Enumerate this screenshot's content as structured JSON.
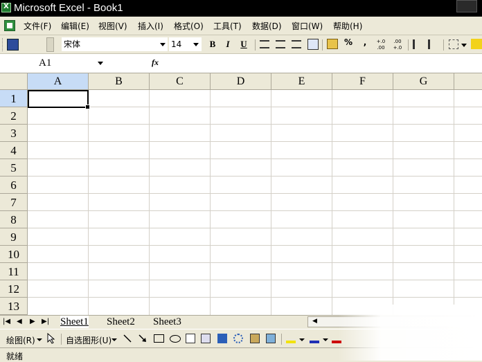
{
  "window": {
    "title": "Microsoft Excel - Book1"
  },
  "menu": [
    "文件(F)",
    "编辑(E)",
    "视图(V)",
    "插入(I)",
    "格式(O)",
    "工具(T)",
    "数据(D)",
    "窗口(W)",
    "帮助(H)"
  ],
  "toolbar": {
    "font_name": "宋体",
    "font_size": "14",
    "bold": "B",
    "italic": "I",
    "underline": "U",
    "percent": "%",
    "comma": ",",
    "increase_decimal": "+.0 .00",
    "decrease_decimal": ".00 +.0"
  },
  "formula_bar": {
    "name_box": "A1",
    "fx": "fx",
    "value": ""
  },
  "grid": {
    "columns": [
      "A",
      "B",
      "C",
      "D",
      "E",
      "F",
      "G"
    ],
    "rows": [
      "1",
      "2",
      "3",
      "4",
      "5",
      "6",
      "7",
      "8",
      "9",
      "10",
      "11",
      "12",
      "13"
    ],
    "active_cell": "A1"
  },
  "sheets": [
    "Sheet1",
    "Sheet2",
    "Sheet3"
  ],
  "drawing_toolbar": {
    "draw_label": "绘图(R)",
    "autoshapes_label": "自选图形(U)"
  },
  "status": {
    "text": "就绪"
  },
  "icons": {
    "nav": [
      "first-sheet-icon",
      "prev-sheet-icon",
      "next-sheet-icon",
      "last-sheet-icon"
    ]
  },
  "colors": {
    "selection_header": "#c7dcf6",
    "app_green": "#1e7a2e"
  }
}
